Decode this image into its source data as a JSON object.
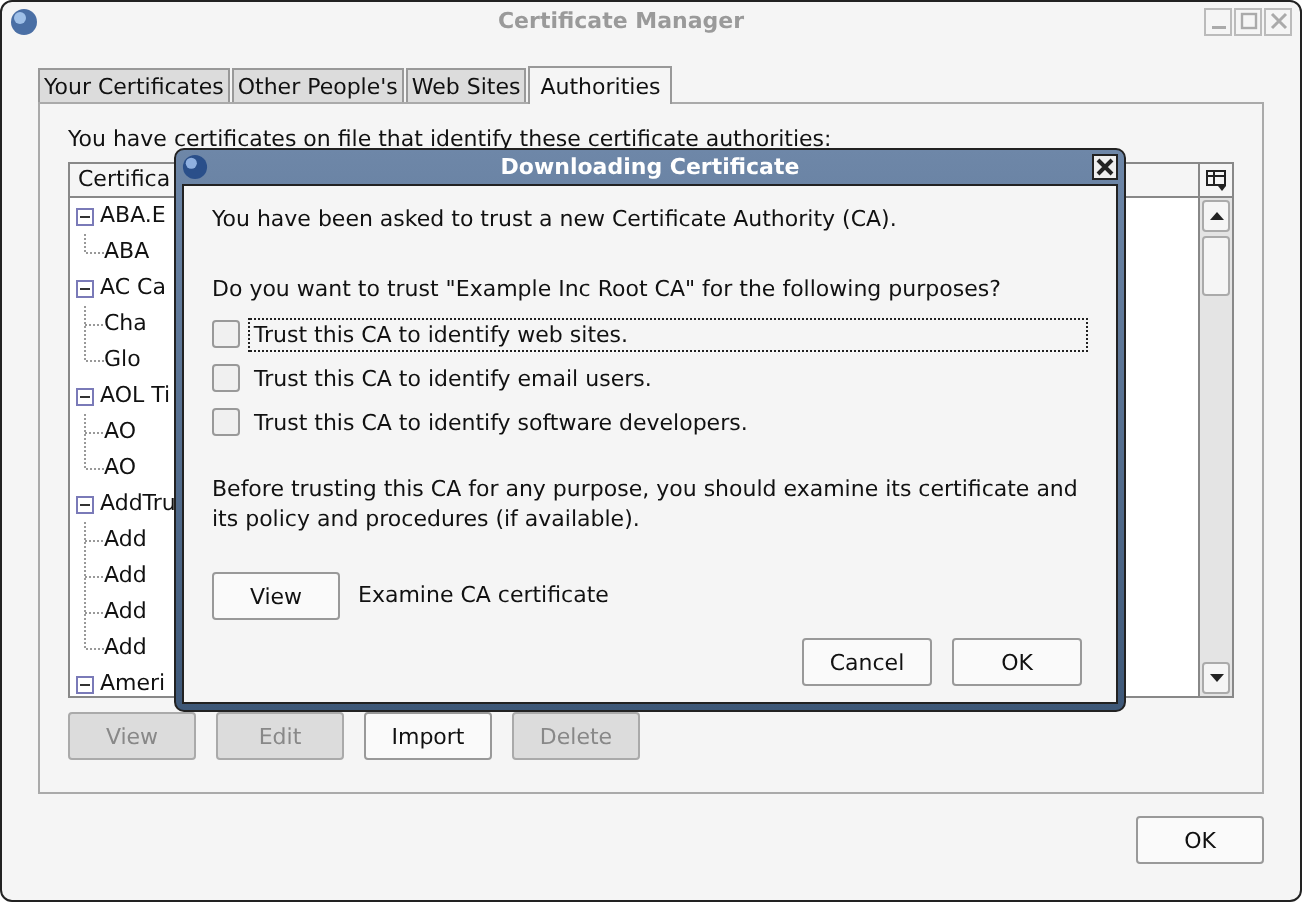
{
  "window": {
    "title": "Certificate Manager",
    "ok_button": "OK"
  },
  "tabs": [
    {
      "label": "Your Certificates",
      "selected": false
    },
    {
      "label": "Other People's",
      "selected": false
    },
    {
      "label": "Web Sites",
      "selected": false
    },
    {
      "label": "Authorities",
      "selected": true
    }
  ],
  "description": "You have certificates on file that identify these certificate authorities:",
  "tree": {
    "columns": [
      "Certifica"
    ],
    "items": [
      {
        "label": "ABA.E",
        "expanded": true,
        "children": [
          {
            "label": "ABA"
          }
        ]
      },
      {
        "label": "AC Ca",
        "expanded": true,
        "children": [
          {
            "label": "Cha"
          },
          {
            "label": "Glo"
          }
        ]
      },
      {
        "label": "AOL Ti",
        "expanded": true,
        "children": [
          {
            "label": "AO"
          },
          {
            "label": "AO"
          }
        ]
      },
      {
        "label": "AddTru",
        "expanded": true,
        "children": [
          {
            "label": "Add"
          },
          {
            "label": "Add"
          },
          {
            "label": "Add"
          },
          {
            "label": "Add"
          }
        ]
      },
      {
        "label": "Ameri",
        "expanded": true
      }
    ]
  },
  "buttons": [
    {
      "label": "View",
      "disabled": true
    },
    {
      "label": "Edit",
      "disabled": true
    },
    {
      "label": "Import",
      "disabled": false
    },
    {
      "label": "Delete",
      "disabled": true
    }
  ],
  "dialog": {
    "title": "Downloading Certificate",
    "intro": "You have been asked to trust a new Certificate Authority (CA).",
    "question": "Do you want to trust \"Example Inc Root CA\" for the following purposes?",
    "options": [
      {
        "label": "Trust this CA to identify web sites.",
        "checked": false,
        "focused": true
      },
      {
        "label": "Trust this CA to identify email users.",
        "checked": false,
        "focused": false
      },
      {
        "label": "Trust this CA to identify software developers.",
        "checked": false,
        "focused": false
      }
    ],
    "note": "Before trusting this CA for any purpose, you should examine its certificate and its policy and procedures (if available).",
    "view_button": "View",
    "view_caption": "Examine CA certificate",
    "buttons": [
      "Cancel",
      "OK"
    ]
  }
}
